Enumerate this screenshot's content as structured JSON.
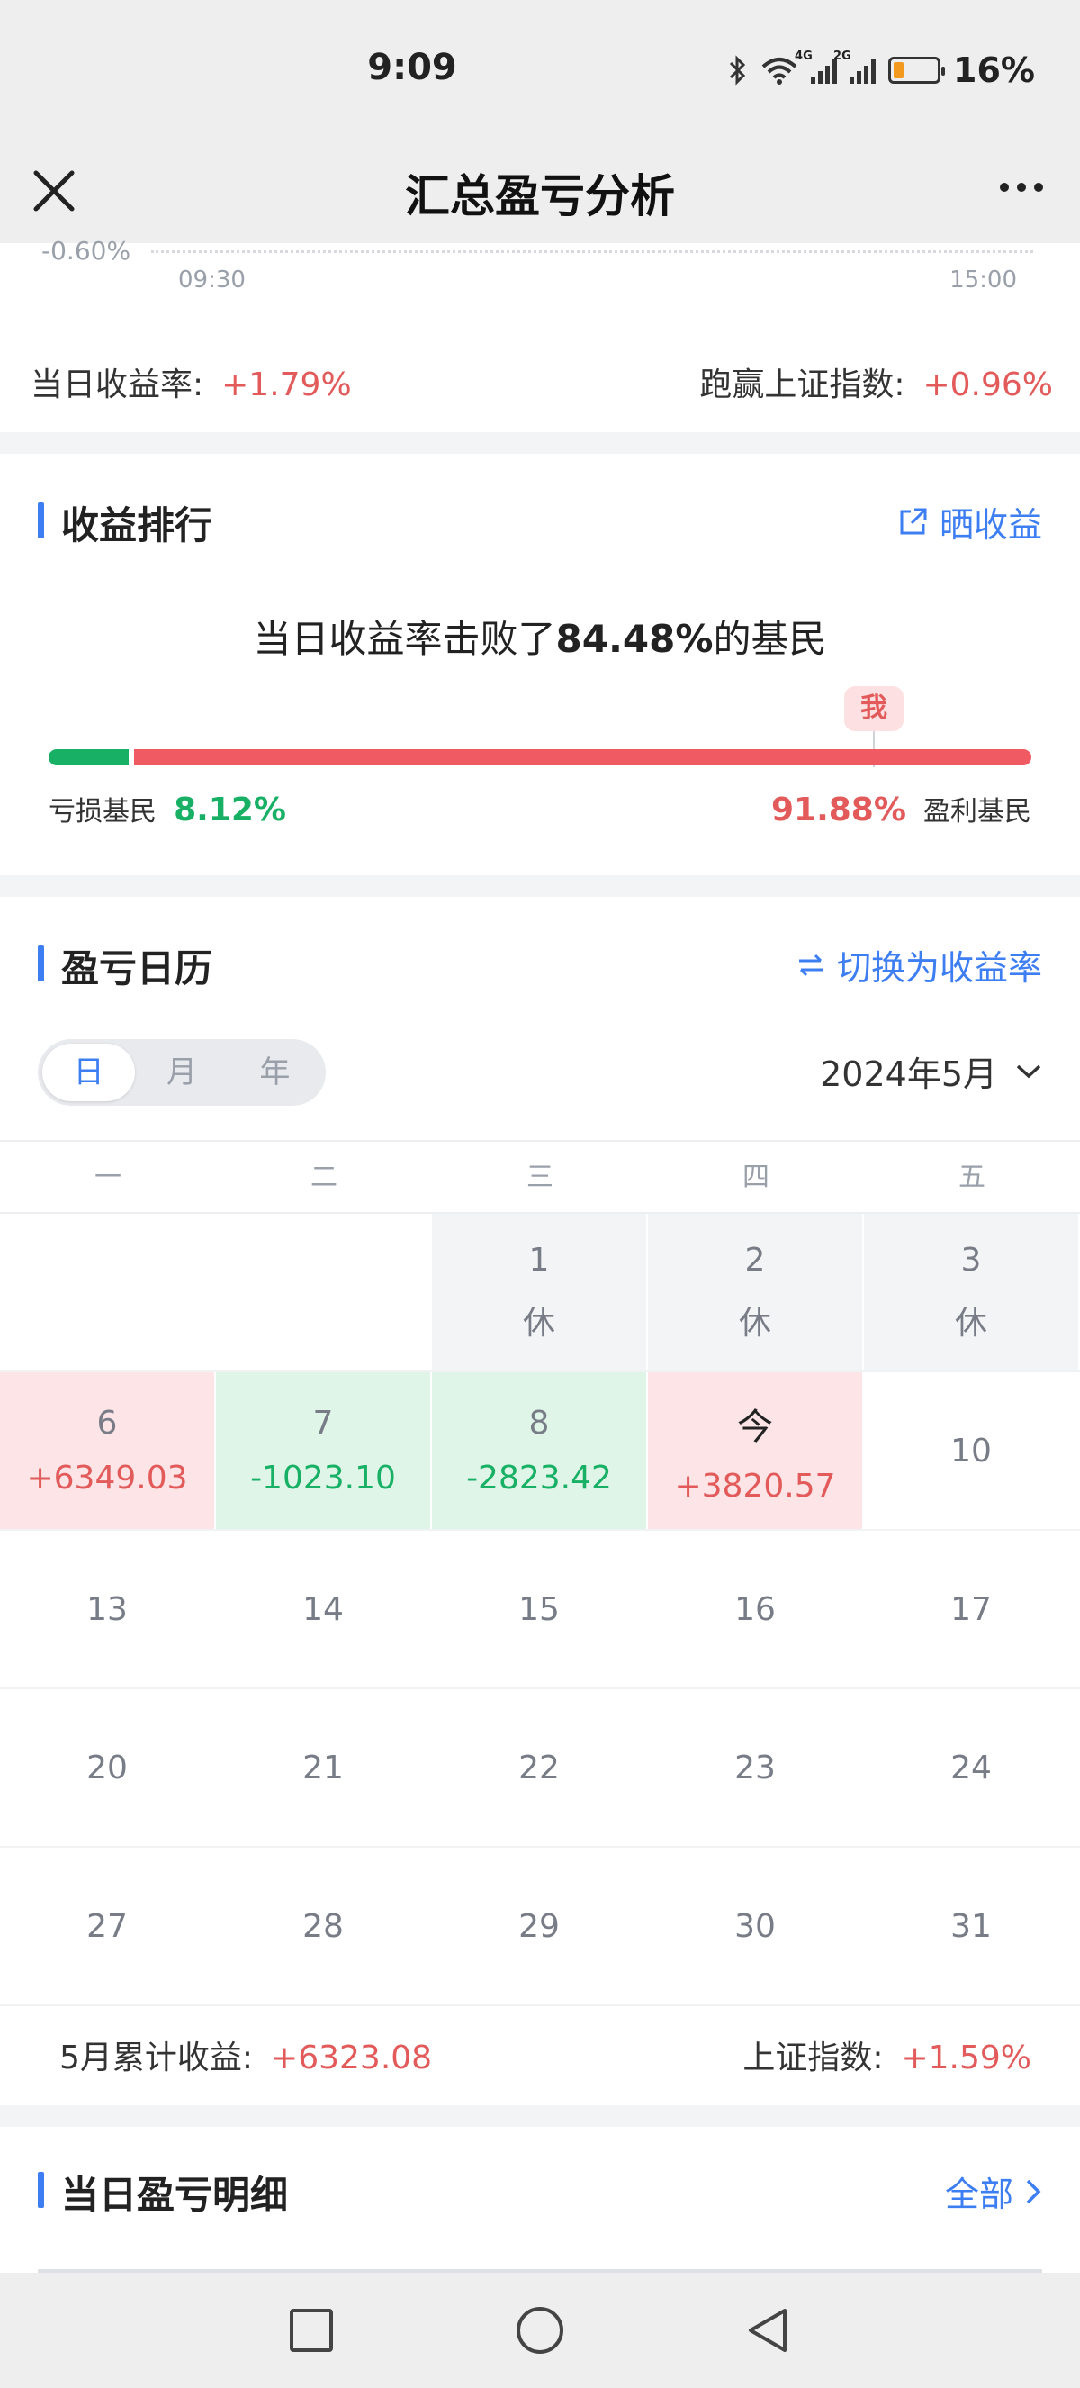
{
  "status": {
    "time": "9:09",
    "net1": "4G",
    "net2": "2G",
    "battery": "16%"
  },
  "nav": {
    "title": "汇总盈亏分析"
  },
  "chart_fragment": {
    "y_label": "-0.60%",
    "x_start": "09:30",
    "x_end": "15:00"
  },
  "daily": {
    "return_label": "当日收益率:",
    "return_value": "+1.79%",
    "beat_label": "跑赢上证指数:",
    "beat_value": "+0.96%"
  },
  "ranking": {
    "title": "收益排行",
    "share_label": "晒收益",
    "text_prefix": "当日收益率击败了",
    "text_pct": "84.48%",
    "text_suffix": "的基民",
    "loss_label": "亏损基民",
    "loss_pct": "8.12%",
    "loss_fraction": 0.0812,
    "profit_pct": "91.88%",
    "profit_label": "盈利基民",
    "me_label": "我",
    "me_fraction": 0.84
  },
  "calendar": {
    "title": "盈亏日历",
    "switch_label": "切换为收益率",
    "tabs": [
      "日",
      "月",
      "年"
    ],
    "active_tab": 0,
    "month": "2024年5月",
    "weekdays": [
      "一",
      "二",
      "三",
      "四",
      "五"
    ],
    "rows": [
      [
        {
          "day": "",
          "value": "",
          "type": "empty"
        },
        {
          "day": "",
          "value": "",
          "type": "empty"
        },
        {
          "day": "1",
          "value": "休",
          "type": "rest"
        },
        {
          "day": "2",
          "value": "休",
          "type": "rest"
        },
        {
          "day": "3",
          "value": "休",
          "type": "rest"
        }
      ],
      [
        {
          "day": "6",
          "value": "+6349.03",
          "type": "up"
        },
        {
          "day": "7",
          "value": "-1023.10",
          "type": "down"
        },
        {
          "day": "8",
          "value": "-2823.42",
          "type": "down"
        },
        {
          "day": "今",
          "value": "+3820.57",
          "type": "up today"
        },
        {
          "day": "10",
          "value": "",
          "type": "plain"
        }
      ],
      [
        {
          "day": "13",
          "value": "",
          "type": "plain"
        },
        {
          "day": "14",
          "value": "",
          "type": "plain"
        },
        {
          "day": "15",
          "value": "",
          "type": "plain"
        },
        {
          "day": "16",
          "value": "",
          "type": "plain"
        },
        {
          "day": "17",
          "value": "",
          "type": "plain"
        }
      ],
      [
        {
          "day": "20",
          "value": "",
          "type": "plain"
        },
        {
          "day": "21",
          "value": "",
          "type": "plain"
        },
        {
          "day": "22",
          "value": "",
          "type": "plain"
        },
        {
          "day": "23",
          "value": "",
          "type": "plain"
        },
        {
          "day": "24",
          "value": "",
          "type": "plain"
        }
      ],
      [
        {
          "day": "27",
          "value": "",
          "type": "plain"
        },
        {
          "day": "28",
          "value": "",
          "type": "plain"
        },
        {
          "day": "29",
          "value": "",
          "type": "plain"
        },
        {
          "day": "30",
          "value": "",
          "type": "plain"
        },
        {
          "day": "31",
          "value": "",
          "type": "plain"
        }
      ]
    ],
    "month_total_label": "5月累计收益:",
    "month_total_value": "+6323.08",
    "index_label": "上证指数:",
    "index_value": "+1.59%"
  },
  "detail": {
    "title": "当日盈亏明细",
    "all_label": "全部"
  },
  "colors": {
    "accent": "#3d7ef2",
    "up": "#e25a5a",
    "down": "#17b064",
    "up_bg": "#fde4e6",
    "down_bg": "#def5e8"
  },
  "icons": {
    "close": "close-icon",
    "more": "more-icon",
    "share": "share-icon",
    "swap": "swap-icon",
    "chevron": "chevron-down-icon",
    "right": "chevron-right-icon"
  }
}
